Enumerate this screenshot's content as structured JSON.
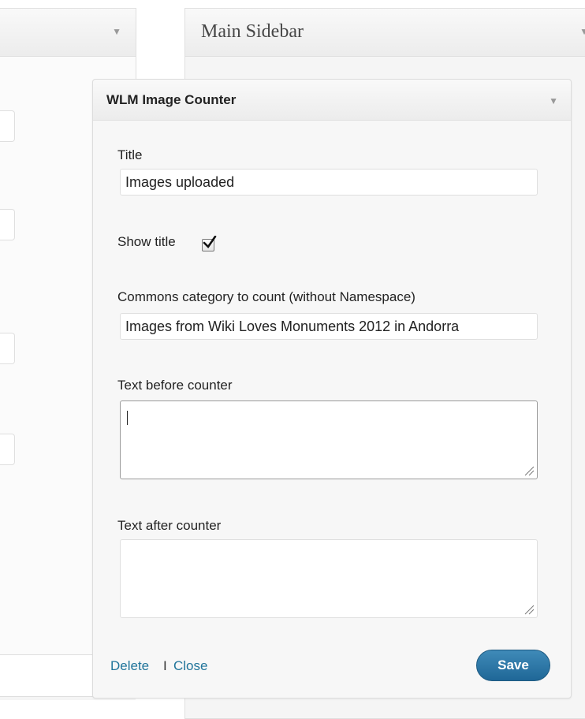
{
  "left_panel": {
    "arrow_icon": "▼"
  },
  "main_sidebar": {
    "title": "Main Sidebar",
    "arrow_icon": "▼"
  },
  "widget": {
    "title": "WLM Image Counter",
    "arrow_icon": "▼",
    "fields": {
      "title": {
        "label": "Title",
        "value": "Images uploaded"
      },
      "show_title": {
        "label": "Show title",
        "checked": true
      },
      "category": {
        "label": "Commons category to count (without Namespace)",
        "value": "Images from Wiki Loves Monuments 2012 in Andorra"
      },
      "text_before": {
        "label": "Text before counter",
        "value": ""
      },
      "text_after": {
        "label": "Text after counter",
        "value": ""
      }
    },
    "actions": {
      "delete": "Delete",
      "separator": "I",
      "close": "Close",
      "save": "Save"
    }
  },
  "colors": {
    "accent": "#21759b",
    "save_button": "#2a6f9f"
  }
}
